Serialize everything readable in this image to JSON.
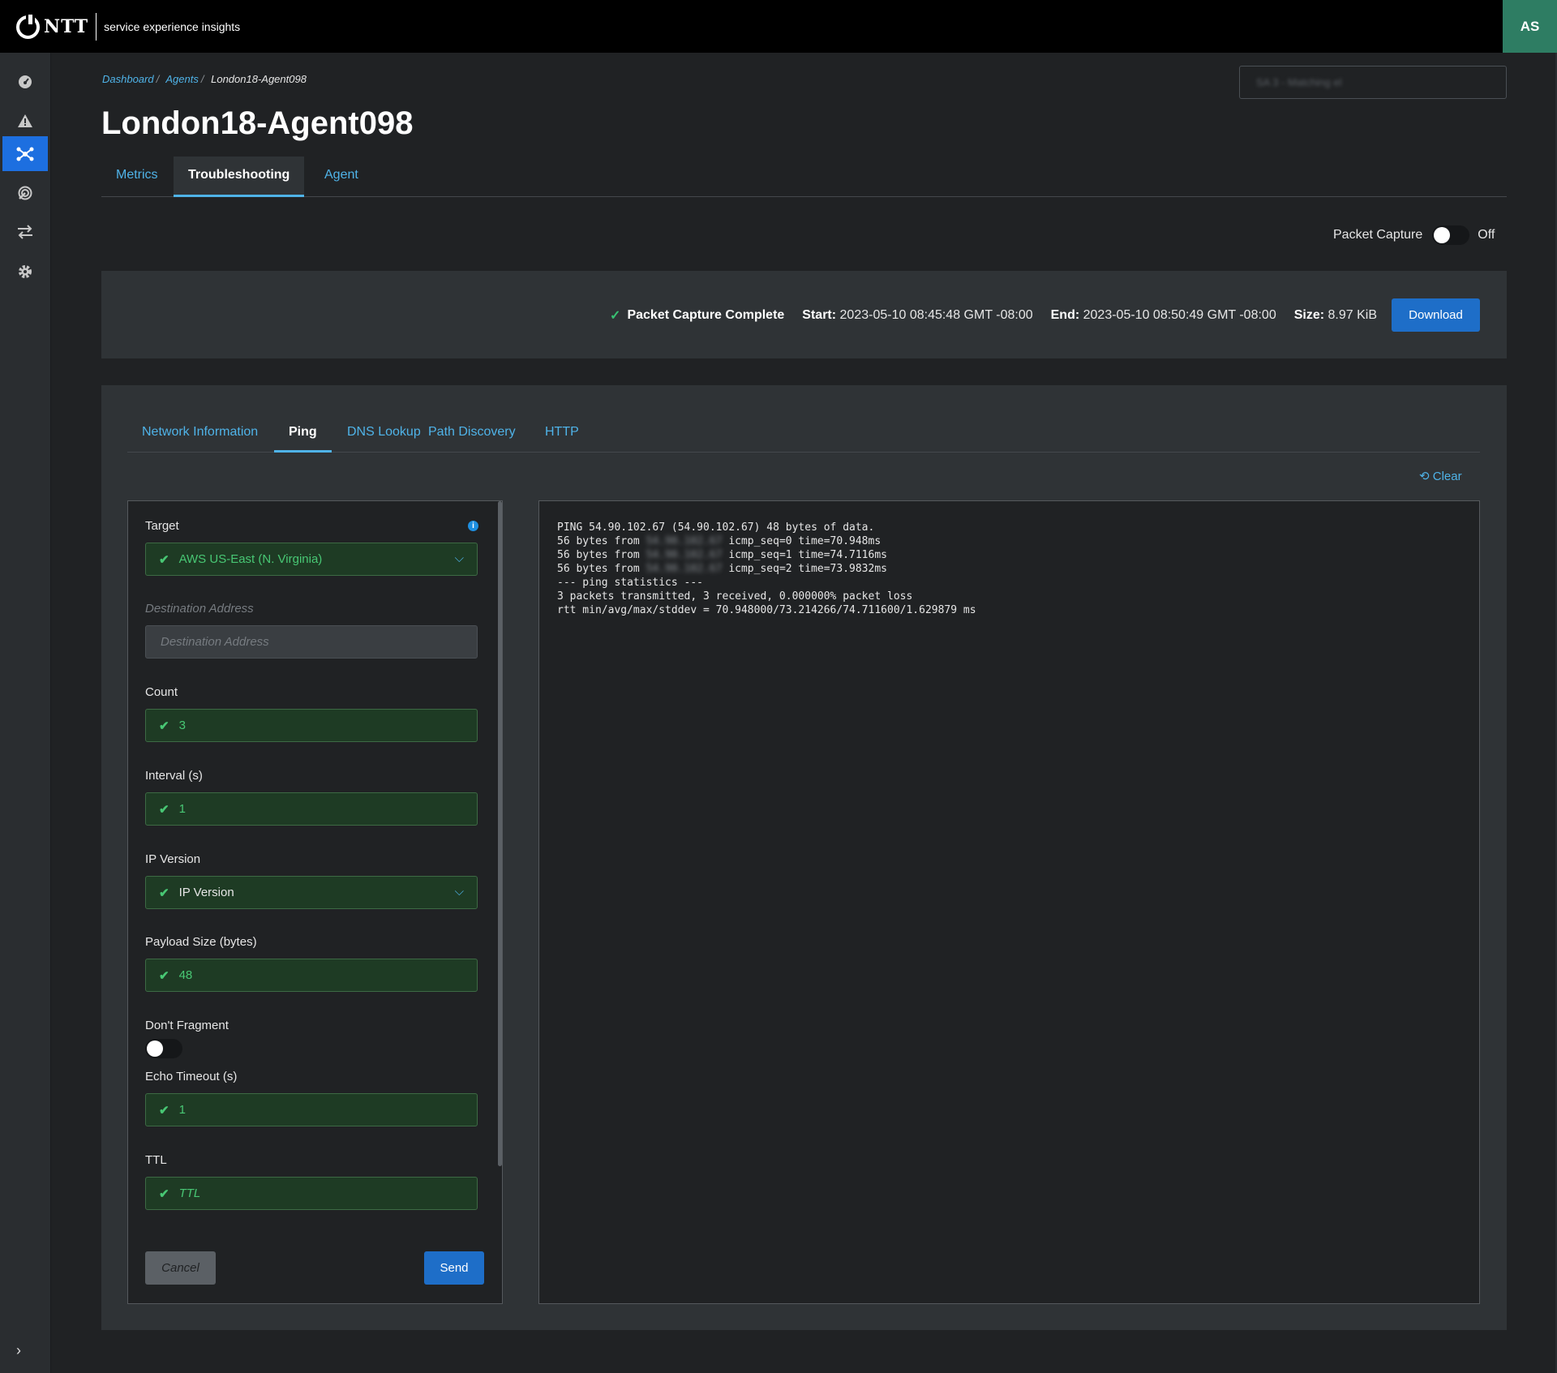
{
  "header": {
    "logo_text": "NTT",
    "product_name": "service experience insights",
    "user_initials": "AS",
    "search_value": "SA 3 - Matching el"
  },
  "sidebar": {
    "items": [
      {
        "name": "dashboard",
        "icon": "dashboard-icon"
      },
      {
        "name": "alerts",
        "icon": "alert-icon"
      },
      {
        "name": "agents",
        "icon": "network-nodes-icon",
        "active": true
      },
      {
        "name": "monitoring",
        "icon": "radar-icon"
      },
      {
        "name": "transfers",
        "icon": "swap-arrows-icon"
      },
      {
        "name": "settings",
        "icon": "gear-icon"
      }
    ],
    "expand_icon": "chevron-right-icon"
  },
  "breadcrumb": {
    "items": [
      "Dashboard",
      "Agents"
    ],
    "current": "London18-Agent098"
  },
  "page": {
    "title": "London18-Agent098",
    "tabs": [
      {
        "label": "Metrics"
      },
      {
        "label": "Troubleshooting",
        "active": true
      },
      {
        "label": "Agent"
      }
    ]
  },
  "packet_capture": {
    "label": "Packet Capture",
    "state": "Off",
    "status": "Packet Capture Complete",
    "start_label": "Start:",
    "start_value": "2023-05-10 08:45:48 GMT -08:00",
    "end_label": "End:",
    "end_value": "2023-05-10 08:50:49 GMT -08:00",
    "size_label": "Size:",
    "size_value": "8.97 KiB",
    "download_label": "Download"
  },
  "tools": {
    "tabs": [
      {
        "label": "Network Information"
      },
      {
        "label": "Ping",
        "active": true
      },
      {
        "label": "DNS Lookup"
      },
      {
        "label": "Path Discovery"
      },
      {
        "label": "HTTP"
      }
    ],
    "clear_label": "Clear"
  },
  "ping_form": {
    "target_label": "Target",
    "target_value": "AWS US-East (N. Virginia)",
    "destination_label": "Destination Address",
    "destination_placeholder": "Destination Address",
    "count_label": "Count",
    "count_value": "3",
    "interval_label": "Interval (s)",
    "interval_value": "1",
    "ip_version_label": "IP Version",
    "ip_version_value": "IP Version",
    "payload_label": "Payload Size (bytes)",
    "payload_value": "48",
    "dont_fragment_label": "Don't Fragment",
    "echo_timeout_label": "Echo Timeout (s)",
    "echo_timeout_value": "1",
    "ttl_label": "TTL",
    "ttl_value": "TTL",
    "cancel_label": "Cancel",
    "send_label": "Send"
  },
  "output": {
    "line0": "PING 54.90.102.67 (54.90.102.67) 48 bytes of data.",
    "line1_pre": "56 bytes from ",
    "line1_ip": "54.90.102.67",
    "line1_post": " icmp_seq=0 time=70.948ms",
    "line2_pre": "56 bytes from ",
    "line2_ip": "54.90.102.67",
    "line2_post": " icmp_seq=1 time=74.7116ms",
    "line3_pre": "56 bytes from ",
    "line3_ip": "54.90.102.67",
    "line3_post": " icmp_seq=2 time=73.9832ms",
    "line4": "--- ping statistics ---",
    "line5": "3 packets transmitted, 3 received, 0.000000% packet loss",
    "line6": "rtt min/avg/max/stddev = 70.948000/73.214266/74.711600/1.629879 ms"
  }
}
